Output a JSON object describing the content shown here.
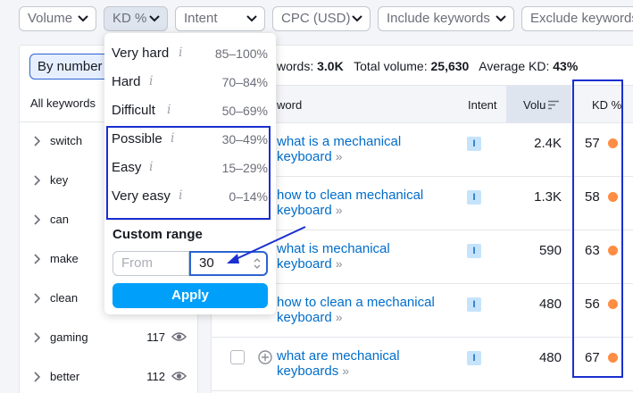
{
  "filters": {
    "volume": "Volume",
    "kd": "KD %",
    "intent": "Intent",
    "cpc": "CPC (USD)",
    "include": "Include keywords",
    "exclude": "Exclude keywords"
  },
  "left_panel": {
    "by_number": "By number",
    "all_keywords": "All keywords",
    "groups": [
      {
        "label": "switch",
        "count": ""
      },
      {
        "label": "key",
        "count": ""
      },
      {
        "label": "can",
        "count": ""
      },
      {
        "label": "make",
        "count": ""
      },
      {
        "label": "clean",
        "count": ""
      },
      {
        "label": "gaming",
        "count": "117"
      },
      {
        "label": "better",
        "count": "112"
      }
    ]
  },
  "summary": {
    "keywords_label": "words:",
    "keywords_value": "3.0K",
    "volume_label": "Total volume:",
    "volume_value": "25,630",
    "kd_label": "Average KD:",
    "kd_value": "43%"
  },
  "table": {
    "headers": {
      "keyword": "word",
      "intent": "Intent",
      "volume": "Volu",
      "kd": "KD %"
    },
    "rows": [
      {
        "keyword_line1": "what is a mechanical",
        "keyword_line2": "keyboard",
        "intent": "I",
        "volume": "2.4K",
        "kd": "57",
        "kd_color": "#ff8c43"
      },
      {
        "keyword_line1": "how to clean mechanical",
        "keyword_line2": "keyboard",
        "intent": "I",
        "volume": "1.3K",
        "kd": "58",
        "kd_color": "#ff8c43"
      },
      {
        "keyword_line1": "what is mechanical",
        "keyword_line2": "keyboard",
        "intent": "I",
        "volume": "590",
        "kd": "63",
        "kd_color": "#ff8c43"
      },
      {
        "keyword_line1": "how to clean a mechanical",
        "keyword_line2": "keyboard",
        "intent": "I",
        "volume": "480",
        "kd": "56",
        "kd_color": "#ff8c43"
      },
      {
        "keyword_line1": "what are mechanical",
        "keyword_line2": "keyboards",
        "intent": "I",
        "volume": "480",
        "kd": "67",
        "kd_color": "#ff8c43"
      }
    ]
  },
  "kd_dropdown": {
    "options": [
      {
        "label": "Very hard",
        "range": "85–100%"
      },
      {
        "label": "Hard",
        "range": "70–84%"
      },
      {
        "label": "Difficult",
        "range": "50–69%"
      },
      {
        "label": "Possible",
        "range": "30–49%"
      },
      {
        "label": "Easy",
        "range": "15–29%"
      },
      {
        "label": "Very easy",
        "range": "0–14%"
      }
    ],
    "info_glyph": "i",
    "custom_range_label": "Custom range",
    "from_placeholder": "From",
    "to_value": "30",
    "apply_label": "Apply"
  },
  "colors": {
    "accent": "#006dca",
    "apply": "#009ff9",
    "annotation": "#1a2fd0",
    "kd_orange": "#ff8c43"
  }
}
